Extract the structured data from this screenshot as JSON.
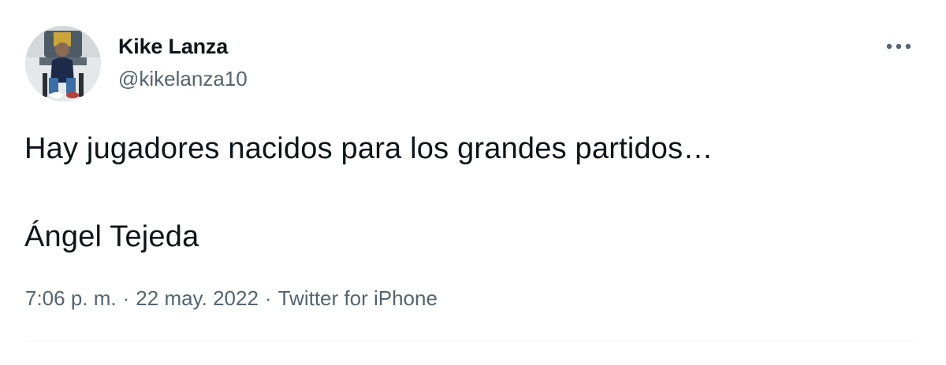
{
  "tweet": {
    "author": {
      "name": "Kike Lanza",
      "handle": "@kikelanza10",
      "avatar": "profile-photo"
    },
    "more_icon": "more-horizontal-icon",
    "text_lines": [
      "Hay jugadores nacidos para los grandes partidos…",
      "Ángel Tejeda"
    ],
    "meta": {
      "time": "7:06 p. m.",
      "separator": "·",
      "date": "22 may. 2022",
      "source": "Twitter for iPhone"
    }
  },
  "colors": {
    "text_primary": "#0f1419",
    "text_secondary": "#536471",
    "divider": "#eff3f4",
    "background": "#ffffff"
  }
}
